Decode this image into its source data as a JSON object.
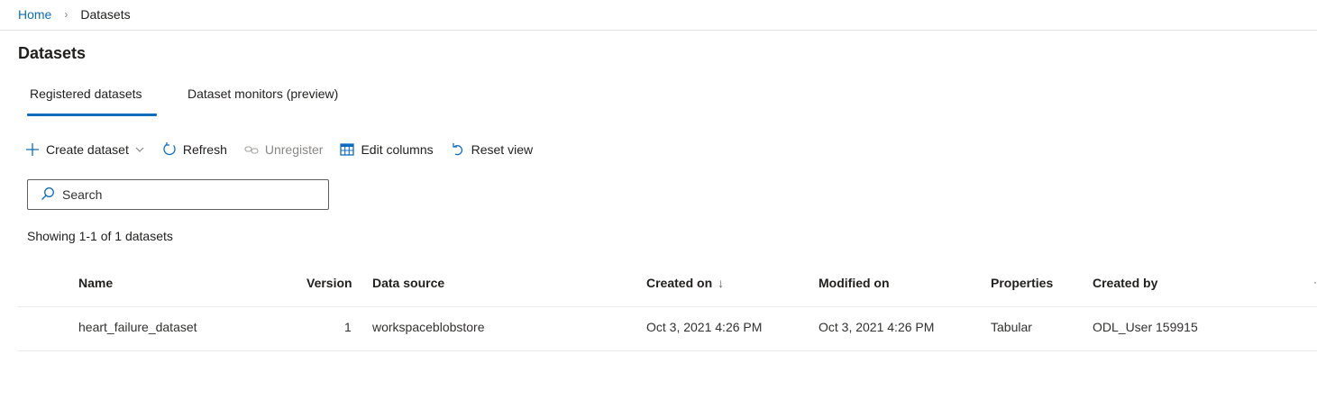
{
  "breadcrumb": {
    "home": "Home",
    "separator": "›",
    "current": "Datasets"
  },
  "page": {
    "title": "Datasets"
  },
  "tabs": [
    {
      "label": "Registered datasets",
      "active": true
    },
    {
      "label": "Dataset monitors (preview)",
      "active": false
    }
  ],
  "toolbar": {
    "create": {
      "label": "Create dataset",
      "icon": "plus-icon"
    },
    "refresh": {
      "label": "Refresh",
      "icon": "refresh-icon"
    },
    "unregister": {
      "label": "Unregister",
      "icon": "unlink-icon",
      "disabled": true
    },
    "edit_columns": {
      "label": "Edit columns",
      "icon": "table-columns-icon"
    },
    "reset_view": {
      "label": "Reset view",
      "icon": "undo-icon"
    }
  },
  "search": {
    "placeholder": "Search",
    "value": ""
  },
  "summary": "Showing 1-1 of 1 datasets",
  "table": {
    "columns": {
      "name": "Name",
      "version": "Version",
      "data_source": "Data source",
      "created_on": "Created on",
      "created_on_sort": "↓",
      "modified_on": "Modified on",
      "properties": "Properties",
      "created_by": "Created by"
    },
    "rows": [
      {
        "name": "heart_failure_dataset",
        "version": "1",
        "data_source": "workspaceblobstore",
        "created_on": "Oct 3, 2021 4:26 PM",
        "modified_on": "Oct 3, 2021 4:26 PM",
        "properties": "Tabular",
        "created_by": "ODL_User 159915"
      }
    ]
  },
  "colors": {
    "accent": "#0f6cbd",
    "text": "#201f1e",
    "muted": "#8a8886",
    "divider": "#edebe9"
  }
}
